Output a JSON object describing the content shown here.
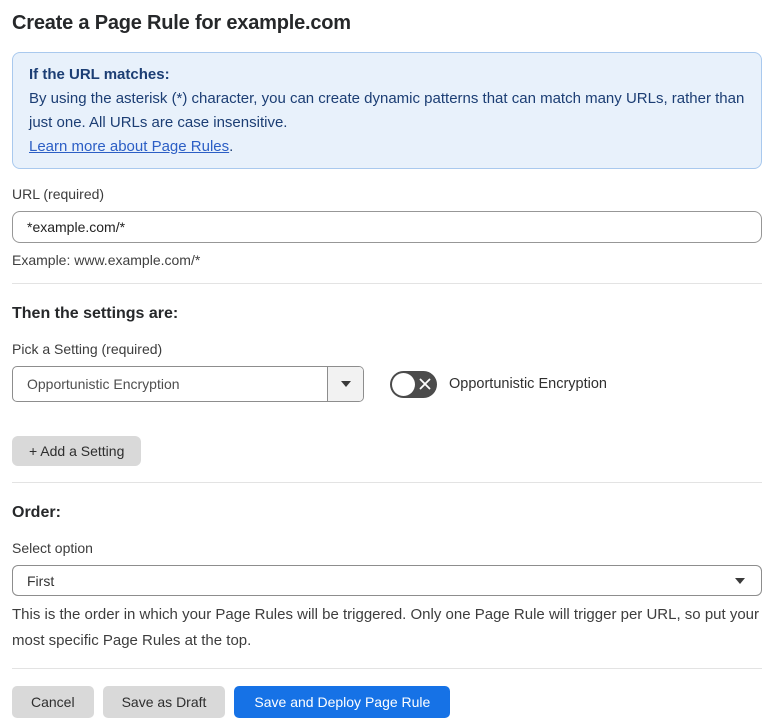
{
  "page": {
    "title": "Create a Page Rule for example.com"
  },
  "info_box": {
    "heading": "If the URL matches:",
    "body": "By using the asterisk (*) character, you can create dynamic patterns that can match many URLs, rather than just one. All URLs are case insensitive.",
    "link_label": "Learn more about Page Rules",
    "link_suffix": "."
  },
  "url_field": {
    "label": "URL (required)",
    "value": "*example.com/*",
    "helper": "Example: www.example.com/*"
  },
  "settings_section": {
    "heading": "Then the settings are:",
    "picker_label": "Pick a Setting (required)",
    "picker_value": "Opportunistic Encryption",
    "toggle_state": "off",
    "toggle_label": "Opportunistic Encryption",
    "add_setting_label": "+ Add a Setting"
  },
  "order_section": {
    "heading": "Order:",
    "select_label": "Select option",
    "select_value": "First",
    "helper": "This is the order in which your Page Rules will be triggered. Only one Page Rule will trigger per URL, so put your most specific Page Rules at the top."
  },
  "footer": {
    "cancel_label": "Cancel",
    "save_draft_label": "Save as Draft",
    "save_deploy_label": "Save and Deploy Page Rule"
  },
  "colors": {
    "info_bg": "#e8f1fb",
    "info_border": "#a9c9ee",
    "info_text": "#1c3e74",
    "link_blue": "#2b5ec5",
    "primary_button_blue": "#1672e6",
    "toggle_off_gray": "#4b4b4b"
  }
}
